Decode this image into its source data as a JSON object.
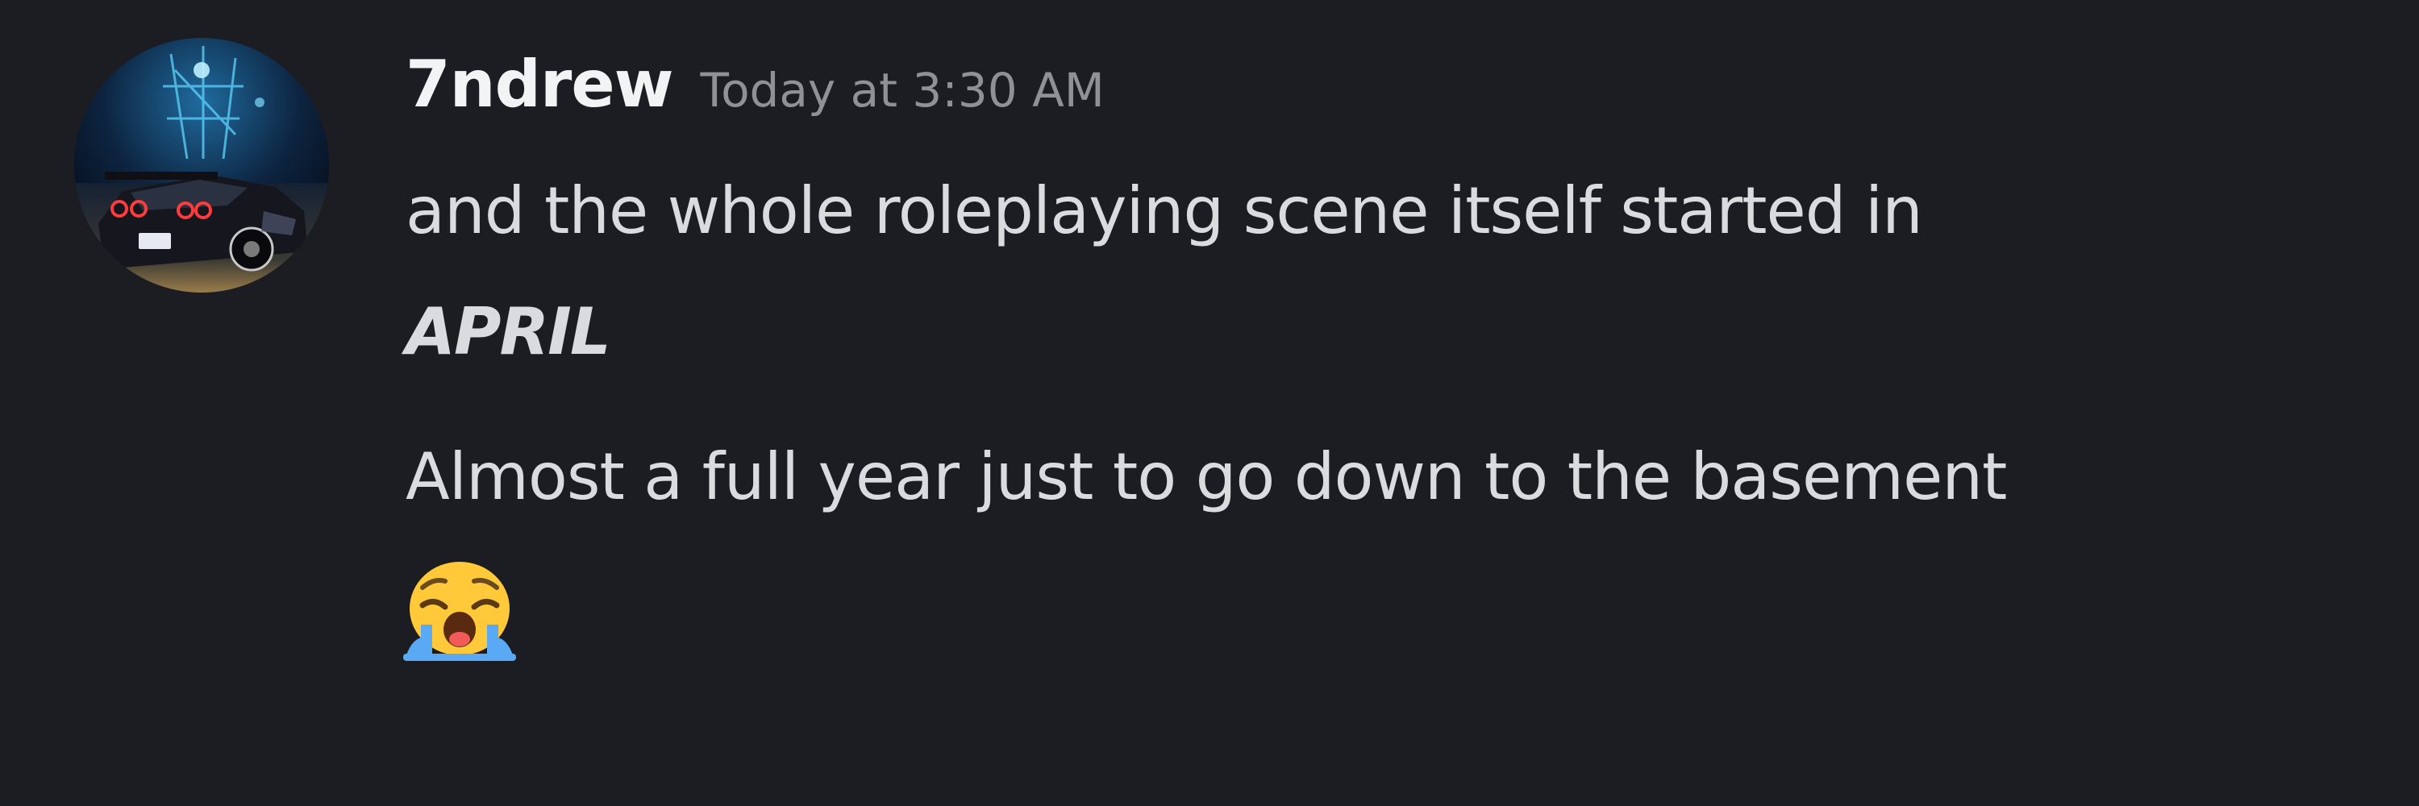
{
  "message": {
    "author": "7ndrew",
    "timestamp": "Today at 3:30 AM",
    "paragraph1_line1": "and the whole roleplaying scene itself started in",
    "paragraph1_line2": "APRIL",
    "paragraph2": "Almost a full year just to go down to the basement",
    "emoji": "loudly-crying-face-icon"
  },
  "colors": {
    "background": "#1c1d22",
    "username": "#f2f3f5",
    "timestamp": "#8e9297",
    "message_text": "#d9dbde"
  }
}
